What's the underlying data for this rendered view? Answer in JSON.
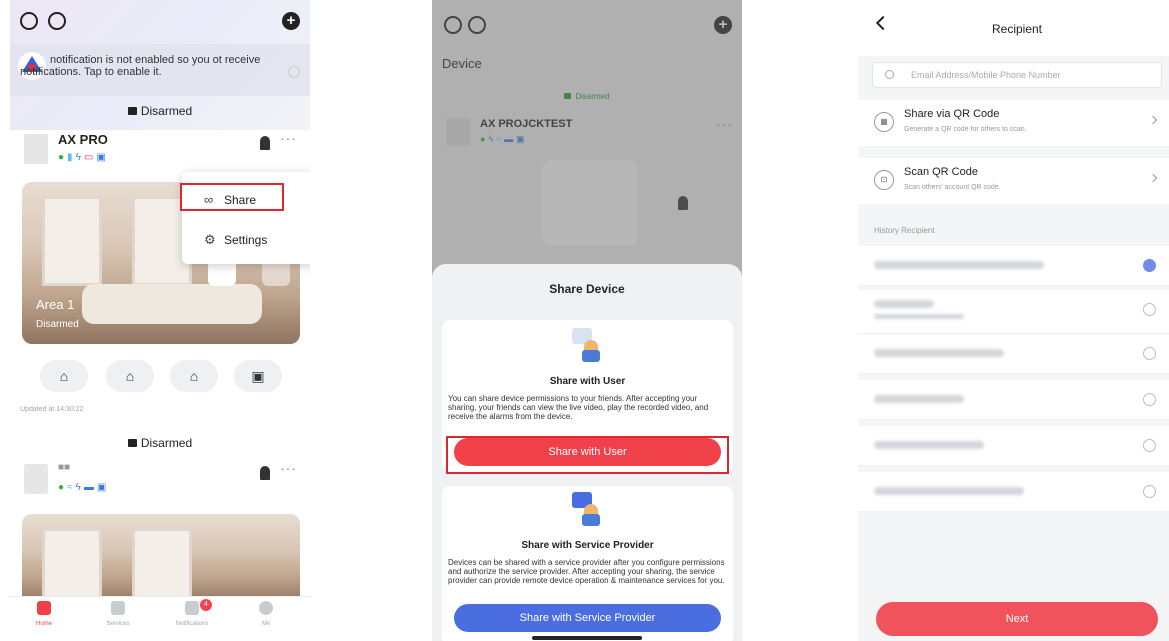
{
  "colors": {
    "accent_red": "#f0414b",
    "accent_blue": "#4a6de0",
    "highlight_box": "#e0252f"
  },
  "screen1": {
    "notification_text": "notification is not enabled so you ot receive notifications. Tap to enable it.",
    "section1_status": "Disarmed",
    "device1_name": "AX PRO",
    "menu": {
      "share_label": "Share",
      "settings_label": "Settings"
    },
    "area_name": "Area 1",
    "area_status": "Disarmed",
    "updated_text": "Updated at 14:30:22",
    "section2_status": "Disarmed",
    "device2_name": "■■",
    "tabs": [
      {
        "label": "Home",
        "icon": "home-icon"
      },
      {
        "label": "Services",
        "icon": "heart-icon"
      },
      {
        "label": "Notifications",
        "icon": "bell-icon",
        "badge": "4"
      },
      {
        "label": "Me",
        "icon": "person-icon"
      }
    ]
  },
  "screen2": {
    "page_title": "Device",
    "status_label": "Disarmed",
    "device_name": "AX PROJCKTEST",
    "sheet_title": "Share Device",
    "user_card": {
      "title": "Share with User",
      "description": "You can share device permissions to your friends. After accepting your sharing, your friends can view the live video, play the recorded video, and receive the alarms from the device.",
      "button": "Share with User"
    },
    "provider_card": {
      "title": "Share with Service Provider",
      "description": "Devices can be shared with a service provider after you configure permissions and authorize the service provider. After accepting your sharing, the service provider can provide remote device operation & maintenance services for you.",
      "button": "Share with Service Provider"
    }
  },
  "screen3": {
    "title": "Recipient",
    "search_placeholder": "Email Address/Mobile Phone Number",
    "options": [
      {
        "title": "Share via QR Code",
        "subtitle": "Generate a QR code for others to scan.",
        "icon": "qr-code-icon"
      },
      {
        "title": "Scan QR Code",
        "subtitle": "Scan others' account QR code.",
        "icon": "scan-icon"
      }
    ],
    "history_label": "History Recipient",
    "history_selected_index": 0,
    "next_button": "Next"
  }
}
